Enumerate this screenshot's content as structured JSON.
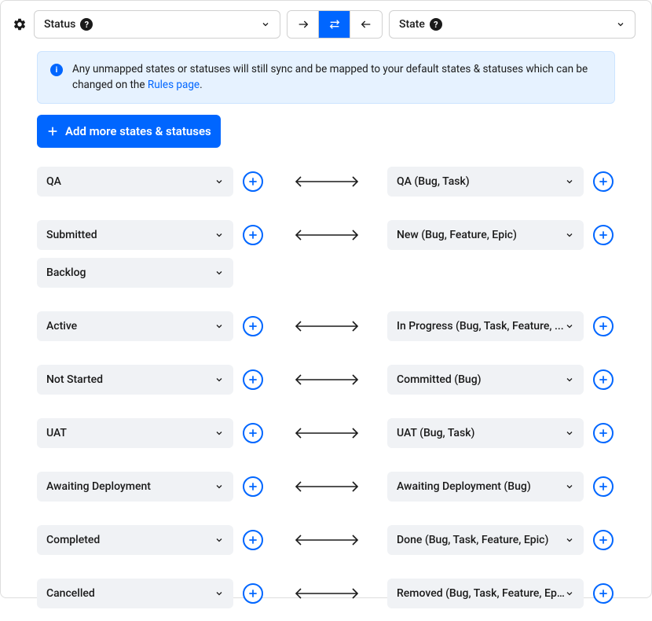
{
  "header": {
    "left_label": "Status",
    "right_label": "State"
  },
  "info": {
    "text_part1": "Any unmapped states or statuses will still sync and be mapped to your default states & statuses which can be changed on the ",
    "link_text": "Rules page",
    "text_part2": "."
  },
  "add_button": "Add more states & statuses",
  "mappings": [
    {
      "left": [
        {
          "label": "QA"
        }
      ],
      "right": [
        {
          "label": "QA (Bug, Task)"
        }
      ]
    },
    {
      "left": [
        {
          "label": "Submitted"
        },
        {
          "label": "Backlog"
        }
      ],
      "right": [
        {
          "label": "New (Bug, Feature, Epic)"
        }
      ]
    },
    {
      "left": [
        {
          "label": "Active"
        }
      ],
      "right": [
        {
          "label": "In Progress (Bug, Task, Feature, ..."
        }
      ]
    },
    {
      "left": [
        {
          "label": "Not Started"
        }
      ],
      "right": [
        {
          "label": "Committed (Bug)"
        }
      ]
    },
    {
      "left": [
        {
          "label": "UAT"
        }
      ],
      "right": [
        {
          "label": "UAT (Bug, Task)"
        }
      ]
    },
    {
      "left": [
        {
          "label": "Awaiting Deployment"
        }
      ],
      "right": [
        {
          "label": "Awaiting Deployment (Bug)"
        }
      ]
    },
    {
      "left": [
        {
          "label": "Completed"
        }
      ],
      "right": [
        {
          "label": "Done (Bug, Task, Feature, Epic)"
        }
      ]
    },
    {
      "left": [
        {
          "label": "Cancelled"
        }
      ],
      "right": [
        {
          "label": "Removed (Bug, Task, Feature, Ep..."
        }
      ]
    }
  ]
}
